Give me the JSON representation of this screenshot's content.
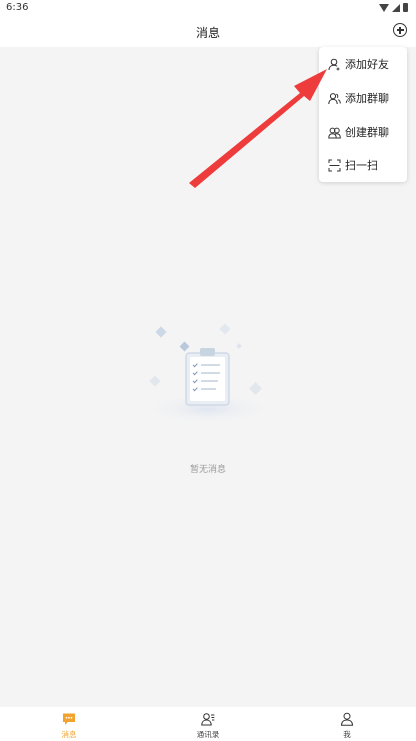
{
  "status_bar": {
    "time": "6:36"
  },
  "header": {
    "title": "消息",
    "add_icon": "plus-circle-icon"
  },
  "popup_menu": {
    "items": [
      {
        "label": "添加好友",
        "icon": "add-friend-icon"
      },
      {
        "label": "添加群聊",
        "icon": "add-group-icon"
      },
      {
        "label": "创建群聊",
        "icon": "create-group-icon"
      },
      {
        "label": "扫一扫",
        "icon": "scan-icon"
      }
    ]
  },
  "annotation": {
    "arrow_color": "#ee3b3b"
  },
  "empty_state": {
    "text": "暂无消息",
    "icon": "clipboard-empty-icon"
  },
  "tab_bar": {
    "active_color": "#f2a32e",
    "items": [
      {
        "label": "消息",
        "icon": "message-icon",
        "active": true
      },
      {
        "label": "通讯录",
        "icon": "contacts-icon",
        "active": false
      },
      {
        "label": "我",
        "icon": "person-icon",
        "active": false
      }
    ]
  }
}
